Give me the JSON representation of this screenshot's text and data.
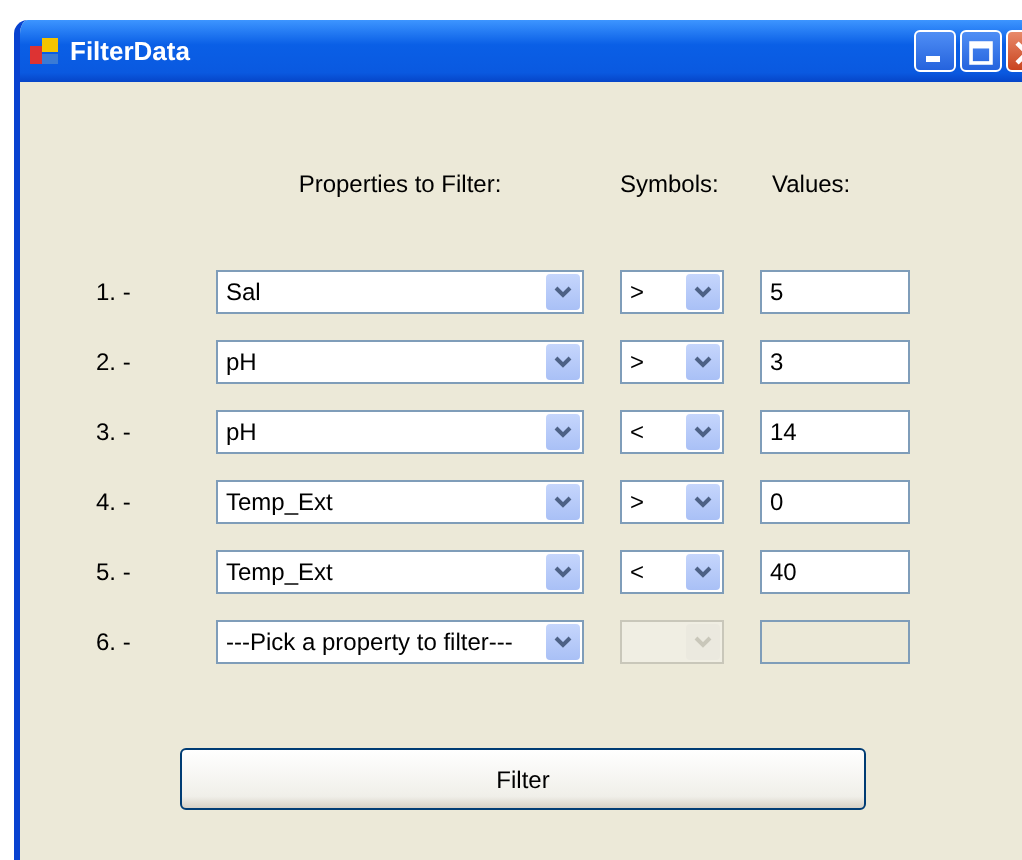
{
  "window": {
    "title": "FilterData"
  },
  "headers": {
    "property": "Properties to Filter:",
    "symbol": "Symbols:",
    "value": "Values:"
  },
  "rows": [
    {
      "number": "1. -",
      "property": "Sal",
      "symbol": ">",
      "value": "5",
      "disabled": false
    },
    {
      "number": "2. -",
      "property": "pH",
      "symbol": ">",
      "value": "3",
      "disabled": false
    },
    {
      "number": "3. -",
      "property": "pH",
      "symbol": "<",
      "value": "14",
      "disabled": false
    },
    {
      "number": "4. -",
      "property": "Temp_Ext",
      "symbol": ">",
      "value": "0",
      "disabled": false
    },
    {
      "number": "5. -",
      "property": "Temp_Ext",
      "symbol": "<",
      "value": "40",
      "disabled": false
    },
    {
      "number": "6. -",
      "property": "---Pick a property to filter---",
      "disabled": true
    }
  ],
  "button": "Filter"
}
